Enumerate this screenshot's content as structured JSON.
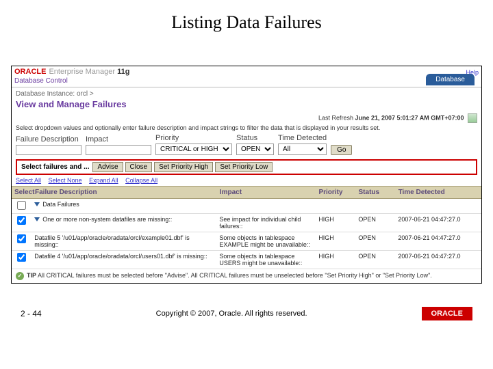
{
  "slide": {
    "title": "Listing Data Failures"
  },
  "brand": {
    "logo": "ORACLE",
    "prod1": "Enterprise Manager",
    "prod2": "11g",
    "sub": "Database Control",
    "help": "Help",
    "tab": "Database"
  },
  "page": {
    "breadcrumb": "Database Instance: orcl >",
    "heading": "View and Manage Failures",
    "refresh_prefix": "Last Refresh",
    "refresh_ts": "June 21, 2007 5:01:27 AM GMT+07:00",
    "hint": "Select dropdown values and optionally enter failure description and impact strings to filter the data that is displayed in your results set."
  },
  "filters": {
    "desc_label": "Failure Description",
    "impact_label": "Impact",
    "priority_label": "Priority",
    "priority_value": "CRITICAL or HIGH",
    "status_label": "Status",
    "status_value": "OPEN",
    "time_label": "Time Detected",
    "time_value": "All",
    "go": "Go"
  },
  "actions": {
    "prefix": "Select failures and ...",
    "advise": "Advise",
    "close": "Close",
    "sph": "Set Priority High",
    "spl": "Set Priority Low"
  },
  "links": {
    "sa": "Select All",
    "sn": "Select None",
    "ea": "Expand All",
    "ca": "Collapse All"
  },
  "cols": {
    "sel": "Select",
    "desc": "Failure Description",
    "imp": "Impact",
    "pri": "Priority",
    "st": "Status",
    "td": "Time Detected"
  },
  "rows": [
    {
      "sel": false,
      "indent": 0,
      "tri": "down",
      "desc": "Data Failures",
      "imp": "",
      "pri": "",
      "st": "",
      "td": ""
    },
    {
      "sel": true,
      "indent": 1,
      "tri": "down",
      "desc": "One or more non-system datafiles are missing::",
      "imp": "See impact for individual child failures::",
      "pri": "HIGH",
      "st": "OPEN",
      "td": "2007-06-21 04:47:27.0"
    },
    {
      "sel": true,
      "indent": 2,
      "tri": "",
      "desc": "Datafile 5 '/u01/app/oracle/oradata/orcl/example01.dbf' is missing::",
      "imp": "Some objects in tablespace EXAMPLE might be unavailable::",
      "pri": "HIGH",
      "st": "OPEN",
      "td": "2007-06-21 04:47:27.0"
    },
    {
      "sel": true,
      "indent": 2,
      "tri": "",
      "desc": "Datafile 4 '/u01/app/oracle/oradata/orcl/users01.dbf' is missing::",
      "imp": "Some objects in tablespace USERS might be unavailable::",
      "pri": "HIGH",
      "st": "OPEN",
      "td": "2007-06-21 04:47:27.0"
    }
  ],
  "tip": {
    "label": "TIP",
    "text": "All CRITICAL failures must be selected before \"Advise\". All CRITICAL failures must be unselected before \"Set Priority High\" or \"Set Priority Low\"."
  },
  "footer": {
    "page": "2 - 44",
    "copyright": "Copyright © 2007, Oracle. All rights reserved.",
    "logo": "ORACLE"
  }
}
